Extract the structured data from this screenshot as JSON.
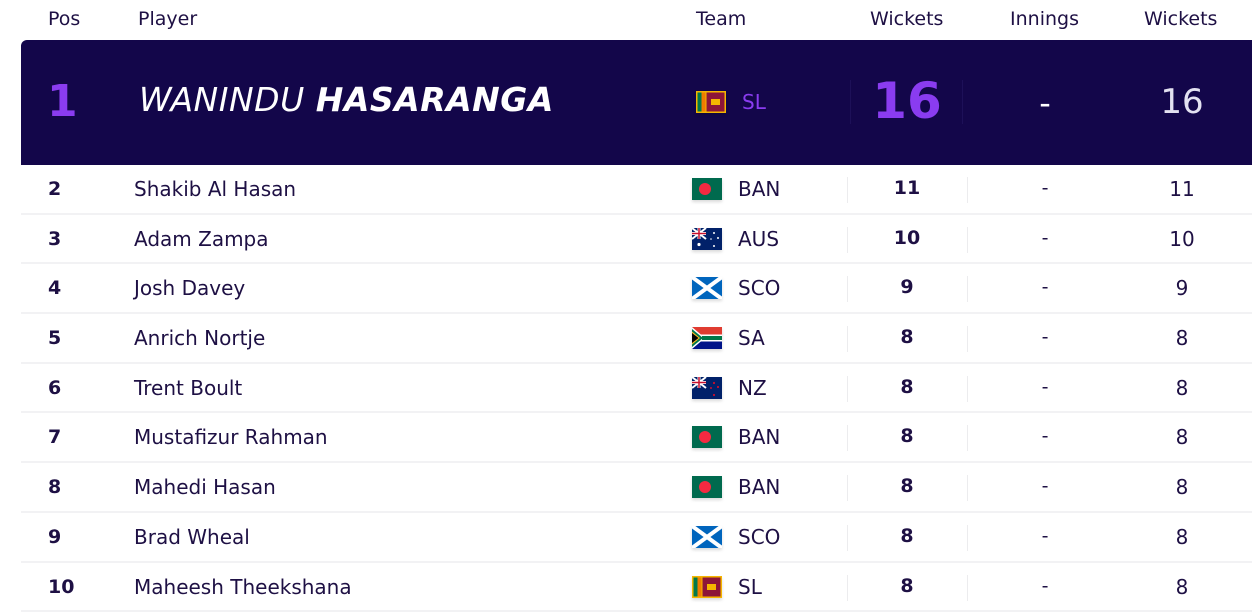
{
  "header": {
    "pos": "Pos",
    "player": "Player",
    "team": "Team",
    "wickets": "Wickets",
    "innings": "Innings",
    "wickets2": "Wickets"
  },
  "colors": {
    "hero_bg": "#13064a",
    "accent": "#8a3cf0",
    "text": "#1e1044"
  },
  "leader": {
    "pos": "1",
    "first_name": "WANINDU",
    "last_name": "HASARANGA",
    "team": "SL",
    "flag": "sri-lanka-flag-icon",
    "wickets": "16",
    "innings": "-",
    "wickets2": "16"
  },
  "rows": [
    {
      "pos": "2",
      "name": "Shakib Al Hasan",
      "team": "BAN",
      "flag": "bangladesh-flag-icon",
      "wickets": "11",
      "innings": "-",
      "wickets2": "11"
    },
    {
      "pos": "3",
      "name": "Adam Zampa",
      "team": "AUS",
      "flag": "australia-flag-icon",
      "wickets": "10",
      "innings": "-",
      "wickets2": "10"
    },
    {
      "pos": "4",
      "name": "Josh Davey",
      "team": "SCO",
      "flag": "scotland-flag-icon",
      "wickets": "9",
      "innings": "-",
      "wickets2": "9"
    },
    {
      "pos": "5",
      "name": "Anrich Nortje",
      "team": "SA",
      "flag": "south-africa-flag-icon",
      "wickets": "8",
      "innings": "-",
      "wickets2": "8"
    },
    {
      "pos": "6",
      "name": "Trent Boult",
      "team": "NZ",
      "flag": "new-zealand-flag-icon",
      "wickets": "8",
      "innings": "-",
      "wickets2": "8"
    },
    {
      "pos": "7",
      "name": "Mustafizur Rahman",
      "team": "BAN",
      "flag": "bangladesh-flag-icon",
      "wickets": "8",
      "innings": "-",
      "wickets2": "8"
    },
    {
      "pos": "8",
      "name": "Mahedi Hasan",
      "team": "BAN",
      "flag": "bangladesh-flag-icon",
      "wickets": "8",
      "innings": "-",
      "wickets2": "8"
    },
    {
      "pos": "9",
      "name": "Brad Wheal",
      "team": "SCO",
      "flag": "scotland-flag-icon",
      "wickets": "8",
      "innings": "-",
      "wickets2": "8"
    },
    {
      "pos": "10",
      "name": "Maheesh Theekshana",
      "team": "SL",
      "flag": "sri-lanka-flag-icon",
      "wickets": "8",
      "innings": "-",
      "wickets2": "8"
    }
  ]
}
